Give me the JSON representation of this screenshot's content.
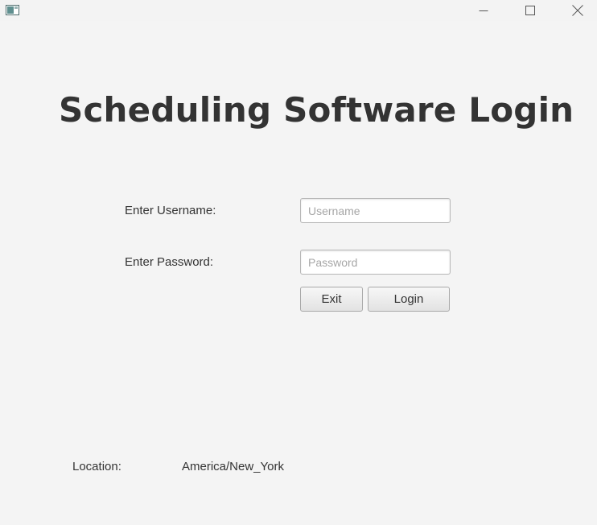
{
  "window": {
    "icon": "java-app-icon",
    "controls": {
      "minimize_icon": "minimize-icon",
      "maximize_icon": "maximize-icon",
      "close_icon": "close-icon"
    }
  },
  "login": {
    "title": "Scheduling Software Login",
    "username_label": "Enter Username:",
    "username_placeholder": "Username",
    "username_value": "",
    "password_label": "Enter Password:",
    "password_placeholder": "Password",
    "password_value": "",
    "exit_label": "Exit",
    "login_label": "Login"
  },
  "footer": {
    "location_label": "Location:",
    "location_value": "America/New_York"
  },
  "colors": {
    "background": "#f4f4f4",
    "text": "#333333",
    "field_border": "#b8b8b8",
    "placeholder": "#a6a6a6"
  }
}
